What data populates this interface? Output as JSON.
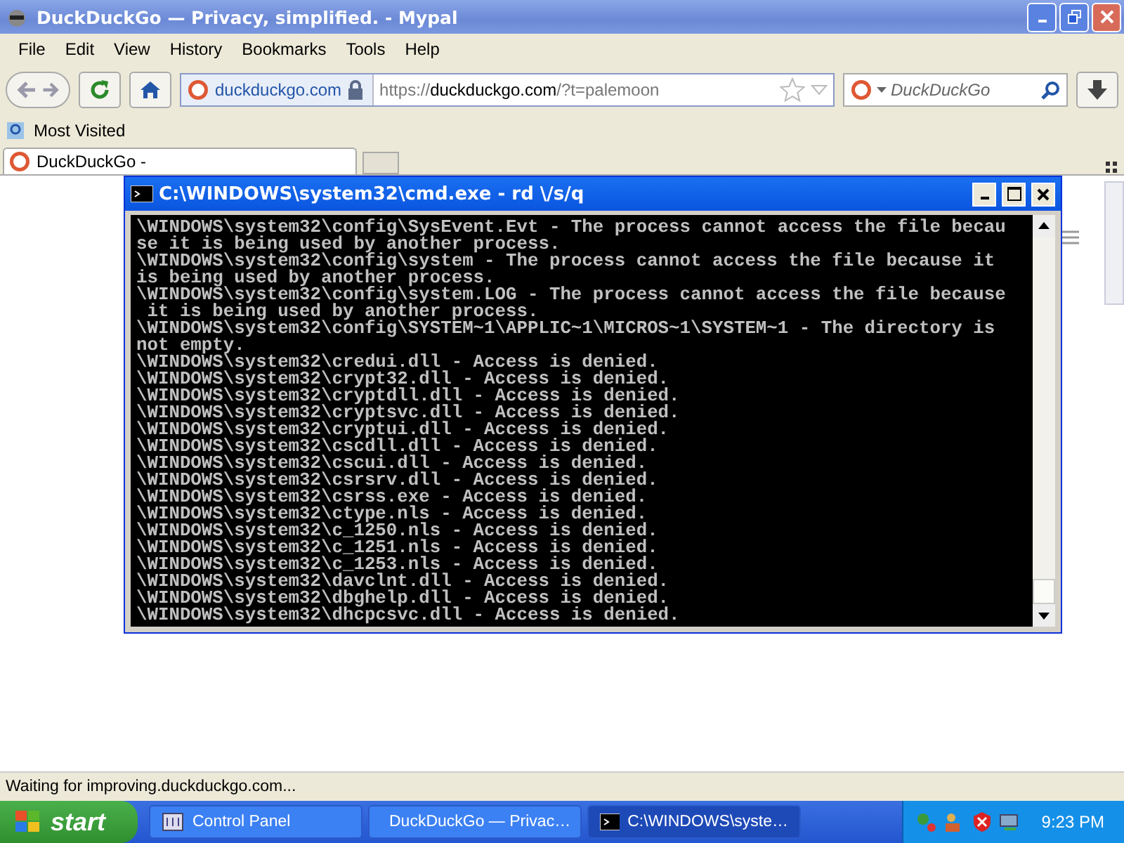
{
  "browser": {
    "title": "DuckDuckGo — Privacy, simplified. - Mypal",
    "menu": [
      "File",
      "Edit",
      "View",
      "History",
      "Bookmarks",
      "Tools",
      "Help"
    ],
    "site_identity": "duckduckgo.com",
    "url": {
      "scheme": "https://",
      "host": "duckduckgo.com",
      "path": "/?t=palemoon"
    },
    "search": {
      "placeholder": "DuckDuckGo"
    },
    "bookmarks": [
      "Most Visited"
    ],
    "tabs": [
      {
        "label": "DuckDuckGo -",
        "selected": true
      }
    ],
    "status_bar": "Waiting for improving.duckduckgo.com..."
  },
  "console_window": {
    "title": "C:\\WINDOWS\\system32\\cmd.exe - rd \\/s/q",
    "lines": [
      "\\WINDOWS\\system32\\config\\SysEvent.Evt - The process cannot access the file becau",
      "se it is being used by another process.",
      "\\WINDOWS\\system32\\config\\system - The process cannot access the file because it",
      "is being used by another process.",
      "\\WINDOWS\\system32\\config\\system.LOG - The process cannot access the file because",
      " it is being used by another process.",
      "\\WINDOWS\\system32\\config\\SYSTEM~1\\APPLIC~1\\MICROS~1\\SYSTEM~1 - The directory is",
      "not empty.",
      "\\WINDOWS\\system32\\credui.dll - Access is denied.",
      "\\WINDOWS\\system32\\crypt32.dll - Access is denied.",
      "\\WINDOWS\\system32\\cryptdll.dll - Access is denied.",
      "\\WINDOWS\\system32\\cryptsvc.dll - Access is denied.",
      "\\WINDOWS\\system32\\cryptui.dll - Access is denied.",
      "\\WINDOWS\\system32\\cscdll.dll - Access is denied.",
      "\\WINDOWS\\system32\\cscui.dll - Access is denied.",
      "\\WINDOWS\\system32\\csrsrv.dll - Access is denied.",
      "\\WINDOWS\\system32\\csrss.exe - Access is denied.",
      "\\WINDOWS\\system32\\ctype.nls - Access is denied.",
      "\\WINDOWS\\system32\\c_1250.nls - Access is denied.",
      "\\WINDOWS\\system32\\c_1251.nls - Access is denied.",
      "\\WINDOWS\\system32\\c_1253.nls - Access is denied.",
      "\\WINDOWS\\system32\\davclnt.dll - Access is denied.",
      "\\WINDOWS\\system32\\dbghelp.dll - Access is denied.",
      "\\WINDOWS\\system32\\dhcpcsvc.dll - Access is denied."
    ]
  },
  "taskbar": {
    "start": "start",
    "items": [
      {
        "label": "Control Panel",
        "kind": "control",
        "selected": false
      },
      {
        "label": "DuckDuckGo — Privac…",
        "kind": "browser",
        "selected": false
      },
      {
        "label": "C:\\WINDOWS\\syste…",
        "kind": "console",
        "selected": true
      }
    ],
    "clock": "9:23 PM"
  }
}
